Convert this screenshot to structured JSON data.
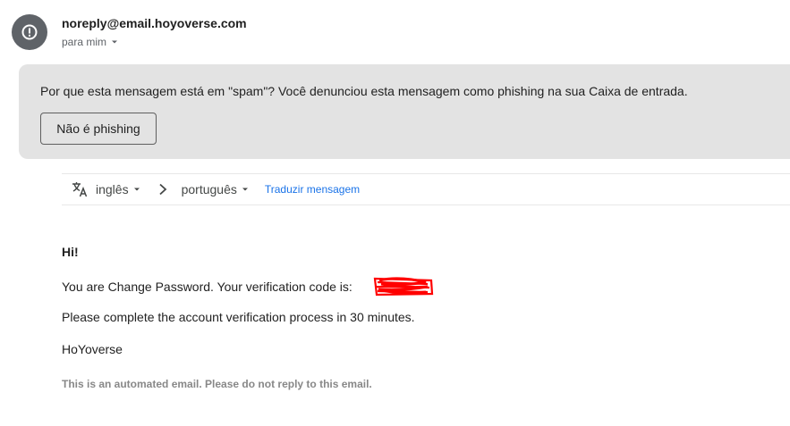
{
  "header": {
    "sender_email": "noreply@email.hoyoverse.com",
    "recipient_label": "para mim",
    "avatar_icon": "exclamation-icon"
  },
  "spam_banner": {
    "message_prefix": "Por que esta mensagem está em \"spam\"?",
    "message_rest": " Você denunciou esta mensagem como phishing na sua Caixa de entrada.",
    "button_label": "Não é phishing",
    "background": "#e3e3e3"
  },
  "translate_bar": {
    "translate_icon": "translate-icon",
    "source_language": "inglês",
    "target_language": "português",
    "translate_link": "Traduzir mensagem",
    "link_color": "#1a73e8"
  },
  "email_body": {
    "greeting": "Hi!",
    "code_line": "You are Change Password. Your verification code is:",
    "code_redaction_color": "#ff0000",
    "instruction": "Please complete the account verification process in 30 minutes.",
    "signature": "HoYoverse",
    "footer_note": "This is an automated email. Please do not reply to this email."
  }
}
